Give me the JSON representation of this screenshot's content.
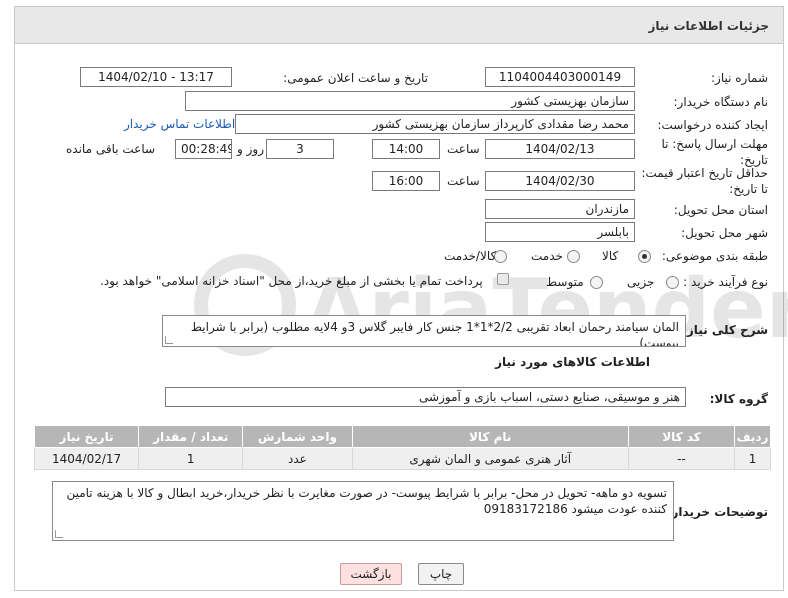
{
  "header": {
    "title": "جزئیات اطلاعات نیاز"
  },
  "labels": {
    "need_number": "شماره نیاز:",
    "announce_datetime": "تاریخ و ساعت اعلان عمومی:",
    "buyer_org": "نام دستگاه خریدار:",
    "requester": "ایجاد کننده درخواست:",
    "reply_deadline_1": "مهلت ارسال پاسخ: تا",
    "reply_deadline_2": "تاریخ:",
    "price_validity_1": "حداقل تاریخ اعتبار قیمت:",
    "price_validity_2": "تا تاریخ:",
    "province": "استان محل تحویل:",
    "city": "شهر محل تحویل:",
    "category": "طبقه بندی موضوعی:",
    "purchase_type": "نوع فرآیند خرید :",
    "time": "ساعت",
    "day_and": "روز و",
    "time_remaining": "ساعت باقی مانده",
    "description": "شرح كلی نیاز:",
    "goods_info": "اطلاعات کالاهای مورد نیاز",
    "goods_group": "گروه کالا:",
    "buyer_notes": "توضیحات خریدار:"
  },
  "values": {
    "need_number": "1104004403000149",
    "announce_datetime": "1404/02/10 - 13:17",
    "buyer_org": "سازمان بهزیستی کشور",
    "requester": "محمد رضا  مقدادی کارپرداز سازمان بهزیستی کشور",
    "contact_link": "اطلاعات تماس خریدار",
    "reply_date": "1404/02/13",
    "reply_time": "14:00",
    "reply_days": "3",
    "reply_remaining": "00:28:49",
    "validity_date": "1404/02/30",
    "validity_time": "16:00",
    "province": "مازندران",
    "city": "بابلسر",
    "description": "المان سیامند رحمان ابعاد تقریبی 2/2*1*1 جنس کار فایبر گلاس 3و 4لایه مطلوب (برابر با شرایط پیوست)",
    "goods_group": "هنر و موسیقی، صنایع دستی، اسباب بازی و آموزشی",
    "buyer_notes": "تسویه دو ماهه- تحویل در محل- برابر با شرایط پیوست- در صورت مغایرت با نظر خریدار،خرید ابطال و کالا با هزینه تامین کننده عودت میشود 09183172186"
  },
  "category_options": {
    "goods": "کالا",
    "service": "خدمت",
    "goods_service": "کالا/خدمت",
    "selected": "کالا"
  },
  "purchase_options": {
    "minor": "جزیی",
    "medium": "متوسط",
    "selected": "none"
  },
  "payment_note": "پرداخت تمام یا بخشی از مبلغ خرید،از محل \"اسناد خزانه اسلامی\" خواهد بود.",
  "table": {
    "headers": [
      "ردیف",
      "کد کالا",
      "نام کالا",
      "واحد شمارش",
      "تعداد / مقدار",
      "تاریخ نیاز"
    ],
    "rows": [
      [
        "1",
        "--",
        "آثار هنری عمومی و المان شهری",
        "عدد",
        "1",
        "1404/02/17"
      ]
    ]
  },
  "buttons": {
    "print": "چاپ",
    "return": "بازگشت"
  },
  "watermark": "AriaTender.neT"
}
